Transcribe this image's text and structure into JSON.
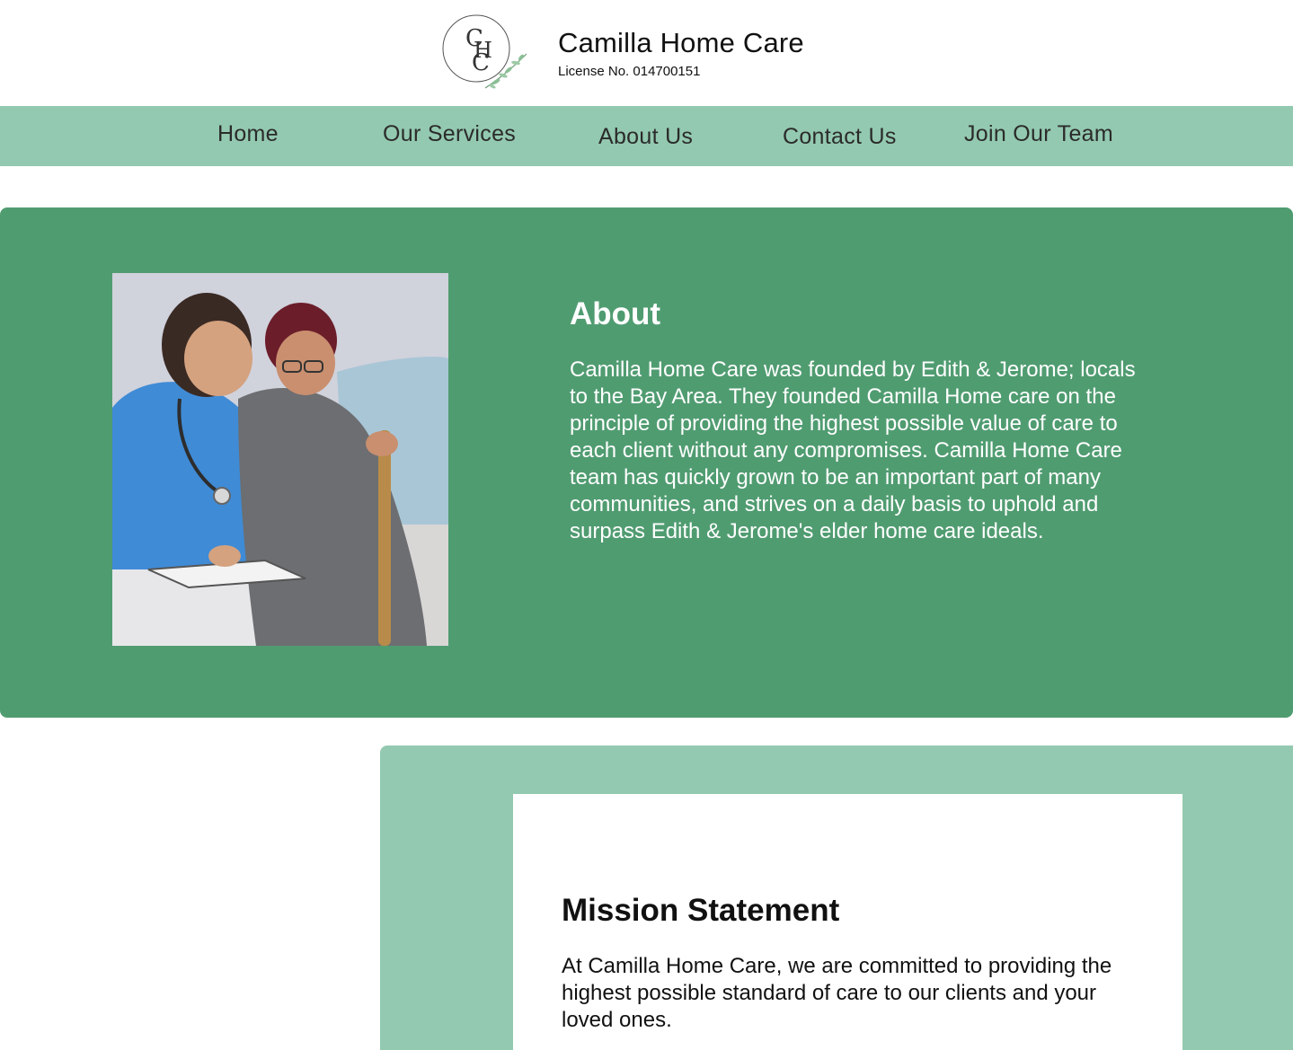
{
  "header": {
    "logo_monogram": "CHC",
    "title": "Camilla Home Care",
    "license": "License No. 014700151"
  },
  "nav": {
    "items": [
      "Home",
      "Our Services",
      "About Us",
      "Contact Us",
      "Join Our Team"
    ]
  },
  "about": {
    "title": "About",
    "body": "Camilla Home Care was founded by Edith & Jerome; locals to the Bay Area. They founded Camilla Home care on the principle of providing the highest possible value of care to each client without any compromises. Camilla Home Care team has quickly grown to be an important part of many communities, and strives on a daily basis to uphold and surpass Edith & Jerome's elder home care ideals."
  },
  "mission": {
    "title": "Mission Statement",
    "body": "At Camilla Home Care, we are committed to providing the highest possible standard of care to our clients and your loved ones."
  },
  "colors": {
    "nav_bg": "#93c9b0",
    "about_bg": "#509c71",
    "mission_bg": "#93c9b0"
  }
}
